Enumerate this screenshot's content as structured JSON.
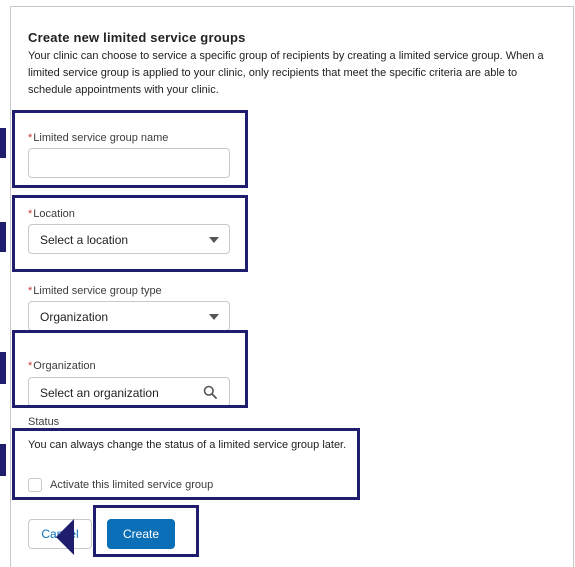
{
  "form": {
    "title": "Create new limited service groups",
    "description": "Your clinic can choose to service a specific group of recipients by creating a limited service group. When a limited service group is applied to your clinic, only recipients that meet the specific criteria are able to schedule appointments with your clinic.",
    "required_marker": "*",
    "group_name": {
      "label": "Limited service group name",
      "value": ""
    },
    "location": {
      "label": "Location",
      "placeholder": "Select a location"
    },
    "group_type": {
      "label": "Limited service group type",
      "value": "Organization"
    },
    "organization": {
      "label": "Organization",
      "placeholder": "Select an organization"
    },
    "status": {
      "label": "Status",
      "help": "You can always change the status of a limited service group later.",
      "checkbox_label": "Activate this limited service group",
      "checked": false
    },
    "buttons": {
      "cancel": "Cancel",
      "create": "Create"
    }
  },
  "colors": {
    "highlight": "#1f1d6e",
    "primary_button": "#0b6fb8",
    "required": "#c23934",
    "border": "#c9c9c9"
  },
  "icons": {
    "select_caret": "chevron-down-icon",
    "organization_search": "search-icon",
    "pointer": "arrow-left-icon"
  }
}
